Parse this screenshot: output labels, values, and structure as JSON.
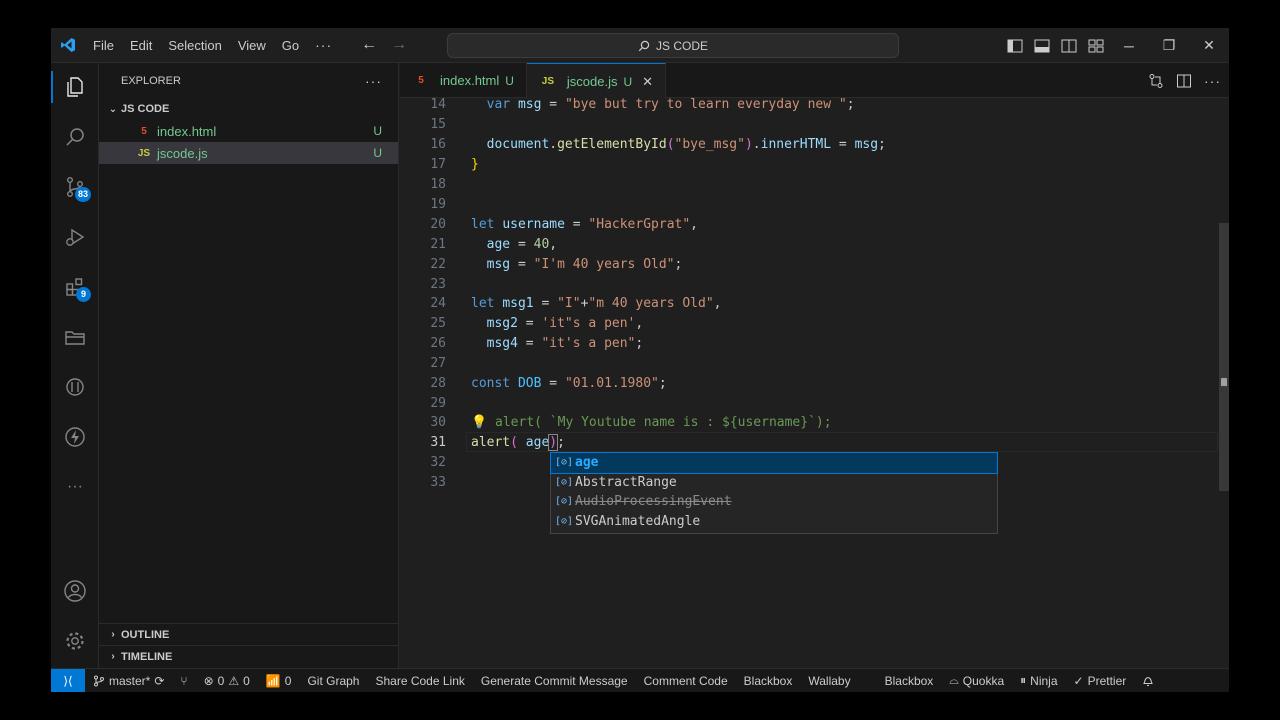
{
  "titlebar": {
    "menu": [
      "File",
      "Edit",
      "Selection",
      "View",
      "Go"
    ],
    "more": "···",
    "search": "JS CODE"
  },
  "activity": {
    "scm_badge": "83",
    "extensions_badge": "9"
  },
  "sidebar": {
    "title": "EXPLORER",
    "more": "···",
    "folder": "JS CODE",
    "files": [
      {
        "name": "index.html",
        "status": "U",
        "icon": "5"
      },
      {
        "name": "jscode.js",
        "status": "U",
        "icon": "JS"
      }
    ],
    "outline": "OUTLINE",
    "timeline": "TIMELINE"
  },
  "tabs": [
    {
      "name": "index.html",
      "status": "U",
      "icon": "5"
    },
    {
      "name": "jscode.js",
      "status": "U",
      "icon": "JS",
      "close": "✕"
    }
  ],
  "editor": {
    "lines": [
      "14",
      "15",
      "16",
      "17",
      "18",
      "19",
      "20",
      "21",
      "22",
      "23",
      "24",
      "25",
      "26",
      "27",
      "28",
      "29",
      "30",
      "31",
      "32",
      "33"
    ]
  },
  "suggest": {
    "items": [
      "age",
      "AbstractRange",
      "AudioProcessingEvent",
      "SVGAnimatedAngle"
    ]
  },
  "statusbar": {
    "branch": "master*",
    "errors": "0",
    "warnings": "0",
    "ports": "0",
    "items_left": [
      "Git Graph",
      "Share Code Link",
      "Generate Commit Message",
      "Comment Code",
      "Blackbox",
      "Wallaby"
    ],
    "blackbox": "Blackbox",
    "quokka": "Quokka",
    "ninja": "Ninja",
    "prettier": "Prettier"
  }
}
